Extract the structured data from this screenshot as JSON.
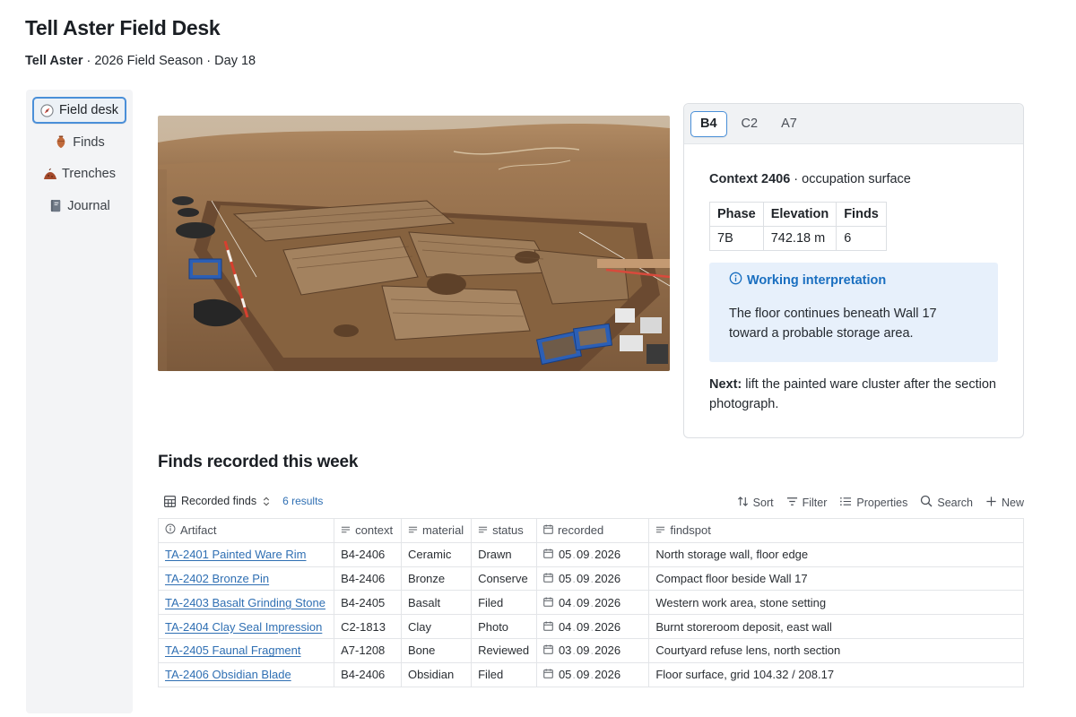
{
  "page": {
    "title": "Tell Aster Field Desk",
    "subtitle_site": "Tell Aster",
    "subtitle_rest": " · 2026 Field Season · Day 18"
  },
  "sidebar": {
    "items": [
      {
        "label": "Field desk",
        "icon": "compass-icon",
        "active": true
      },
      {
        "label": "Finds",
        "icon": "amphora-icon",
        "active": false
      },
      {
        "label": "Trenches",
        "icon": "dirt-mound-icon",
        "active": false
      },
      {
        "label": "Journal",
        "icon": "notebook-icon",
        "active": false
      }
    ]
  },
  "context_card": {
    "tabs": [
      "B4",
      "C2",
      "A7"
    ],
    "active_tab": "B4",
    "context_label": "Context 2406",
    "context_desc": " · occupation surface",
    "summary_headers": [
      "Phase",
      "Elevation",
      "Finds"
    ],
    "summary_values": [
      "7B",
      "742.18 m",
      "6"
    ],
    "callout_title": "Working interpretation",
    "callout_body": "The floor continues beneath Wall 17 toward a probable storage area.",
    "next_label": "Next:",
    "next_text": " lift the painted ware cluster after the section photograph."
  },
  "finds": {
    "section_title": "Finds recorded this week",
    "view_name": "Recorded finds",
    "result_count": "6 results",
    "toolbar": {
      "sort": "Sort",
      "filter": "Filter",
      "properties": "Properties",
      "search": "Search",
      "new": "New"
    },
    "columns": [
      "Artifact",
      "context",
      "material",
      "status",
      "recorded",
      "findspot"
    ],
    "rows": [
      {
        "artifact": "TA-2401 Painted Ware Rim",
        "context": "B4-2406",
        "material": "Ceramic",
        "status": "Drawn",
        "date": [
          "05",
          "09",
          "2026"
        ],
        "findspot": "North storage wall, floor edge"
      },
      {
        "artifact": "TA-2402 Bronze Pin",
        "context": "B4-2406",
        "material": "Bronze",
        "status": "Conserve",
        "date": [
          "05",
          "09",
          "2026"
        ],
        "findspot": "Compact floor beside Wall 17"
      },
      {
        "artifact": "TA-2403 Basalt Grinding Stone",
        "context": "B4-2405",
        "material": "Basalt",
        "status": "Filed",
        "date": [
          "04",
          "09",
          "2026"
        ],
        "findspot": "Western work area, stone setting"
      },
      {
        "artifact": "TA-2404 Clay Seal Impression",
        "context": "C2-1813",
        "material": "Clay",
        "status": "Photo",
        "date": [
          "04",
          "09",
          "2026"
        ],
        "findspot": "Burnt storeroom deposit, east wall"
      },
      {
        "artifact": "TA-2405 Faunal Fragment",
        "context": "A7-1208",
        "material": "Bone",
        "status": "Reviewed",
        "date": [
          "03",
          "09",
          "2026"
        ],
        "findspot": "Courtyard refuse lens, north section"
      },
      {
        "artifact": "TA-2406 Obsidian Blade",
        "context": "B4-2406",
        "material": "Obsidian",
        "status": "Filed",
        "date": [
          "05",
          "09",
          "2026"
        ],
        "findspot": "Floor surface, grid 104.32 / 208.17"
      }
    ]
  }
}
